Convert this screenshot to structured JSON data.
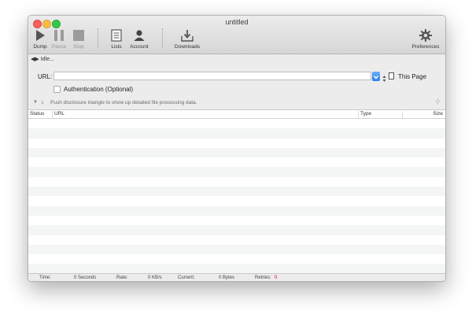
{
  "window": {
    "title": "untitled"
  },
  "toolbar": {
    "dump": "Dump",
    "pause": "Pause",
    "stop": "Stop",
    "lists": "Lists",
    "account": "Account",
    "downloads": "Downloads",
    "preferences": "Preferences"
  },
  "status": {
    "text": "Idle..."
  },
  "url": {
    "label": "URL:",
    "value": "",
    "scope": "This Page"
  },
  "auth": {
    "label": "Authentication (Optional)",
    "checked": false
  },
  "disclosure": {
    "text": "Push disclosure triangle to show up detailed file processing data."
  },
  "table": {
    "columns": [
      "Status",
      "URL",
      "Type",
      "Size"
    ],
    "rows": []
  },
  "footer": {
    "time_label": "Time:",
    "time_value": "0 Seconds",
    "rate_label": "Rate:",
    "rate_value": "0 KB/s",
    "current_label": "Current:",
    "current_value": "0 Bytes",
    "retries_label": "Retries:",
    "retries_value": "0"
  },
  "colors": {
    "accent": "#2e7ef0",
    "retries": "#d0021b"
  }
}
